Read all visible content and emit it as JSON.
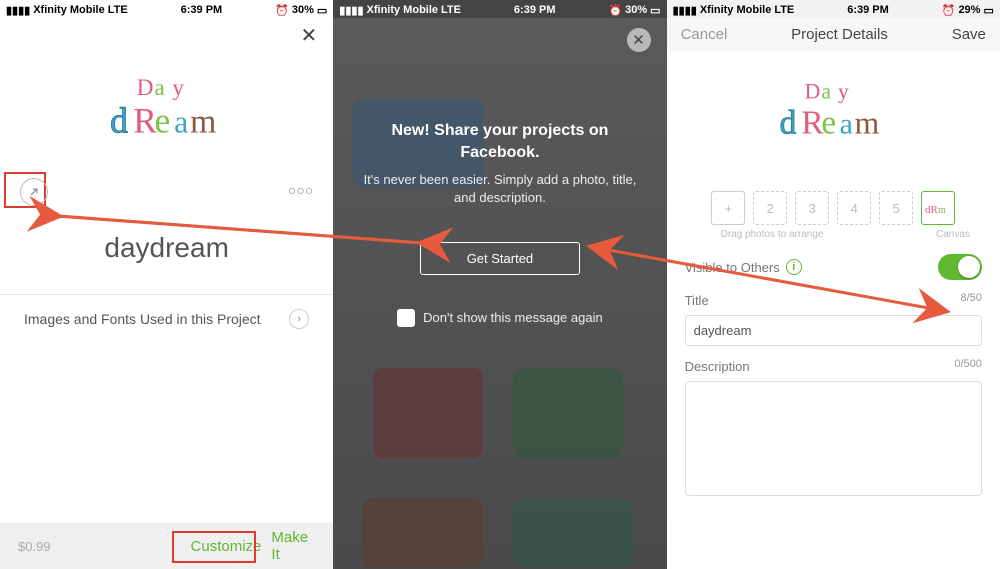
{
  "status": {
    "carrier": "Xfinity Mobile",
    "network": "LTE",
    "time": "6:39 PM",
    "battery_s12": "30%",
    "battery_s3": "29%"
  },
  "screen1": {
    "project_title": "daydream",
    "images_fonts_label": "Images and Fonts Used in this Project",
    "price": "$0.99",
    "customize": "Customize",
    "make_it": "Make It"
  },
  "screen2": {
    "heading": "New! Share your projects on Facebook.",
    "subtext": "It's never been easier. Simply add a photo, title, and description.",
    "cta": "Get Started",
    "dont_show": "Don't show this message again"
  },
  "screen3": {
    "cancel": "Cancel",
    "title": "Project Details",
    "save": "Save",
    "thumbs": {
      "add": "+",
      "n2": "2",
      "n3": "3",
      "n4": "4",
      "n5": "5",
      "drag_label": "Drag photos to arrange",
      "canvas_label": "Canvas"
    },
    "visible_label": "Visible to Others",
    "title_label": "Title",
    "title_value": "daydream",
    "title_count": "8/50",
    "desc_label": "Description",
    "desc_count": "0/500"
  }
}
